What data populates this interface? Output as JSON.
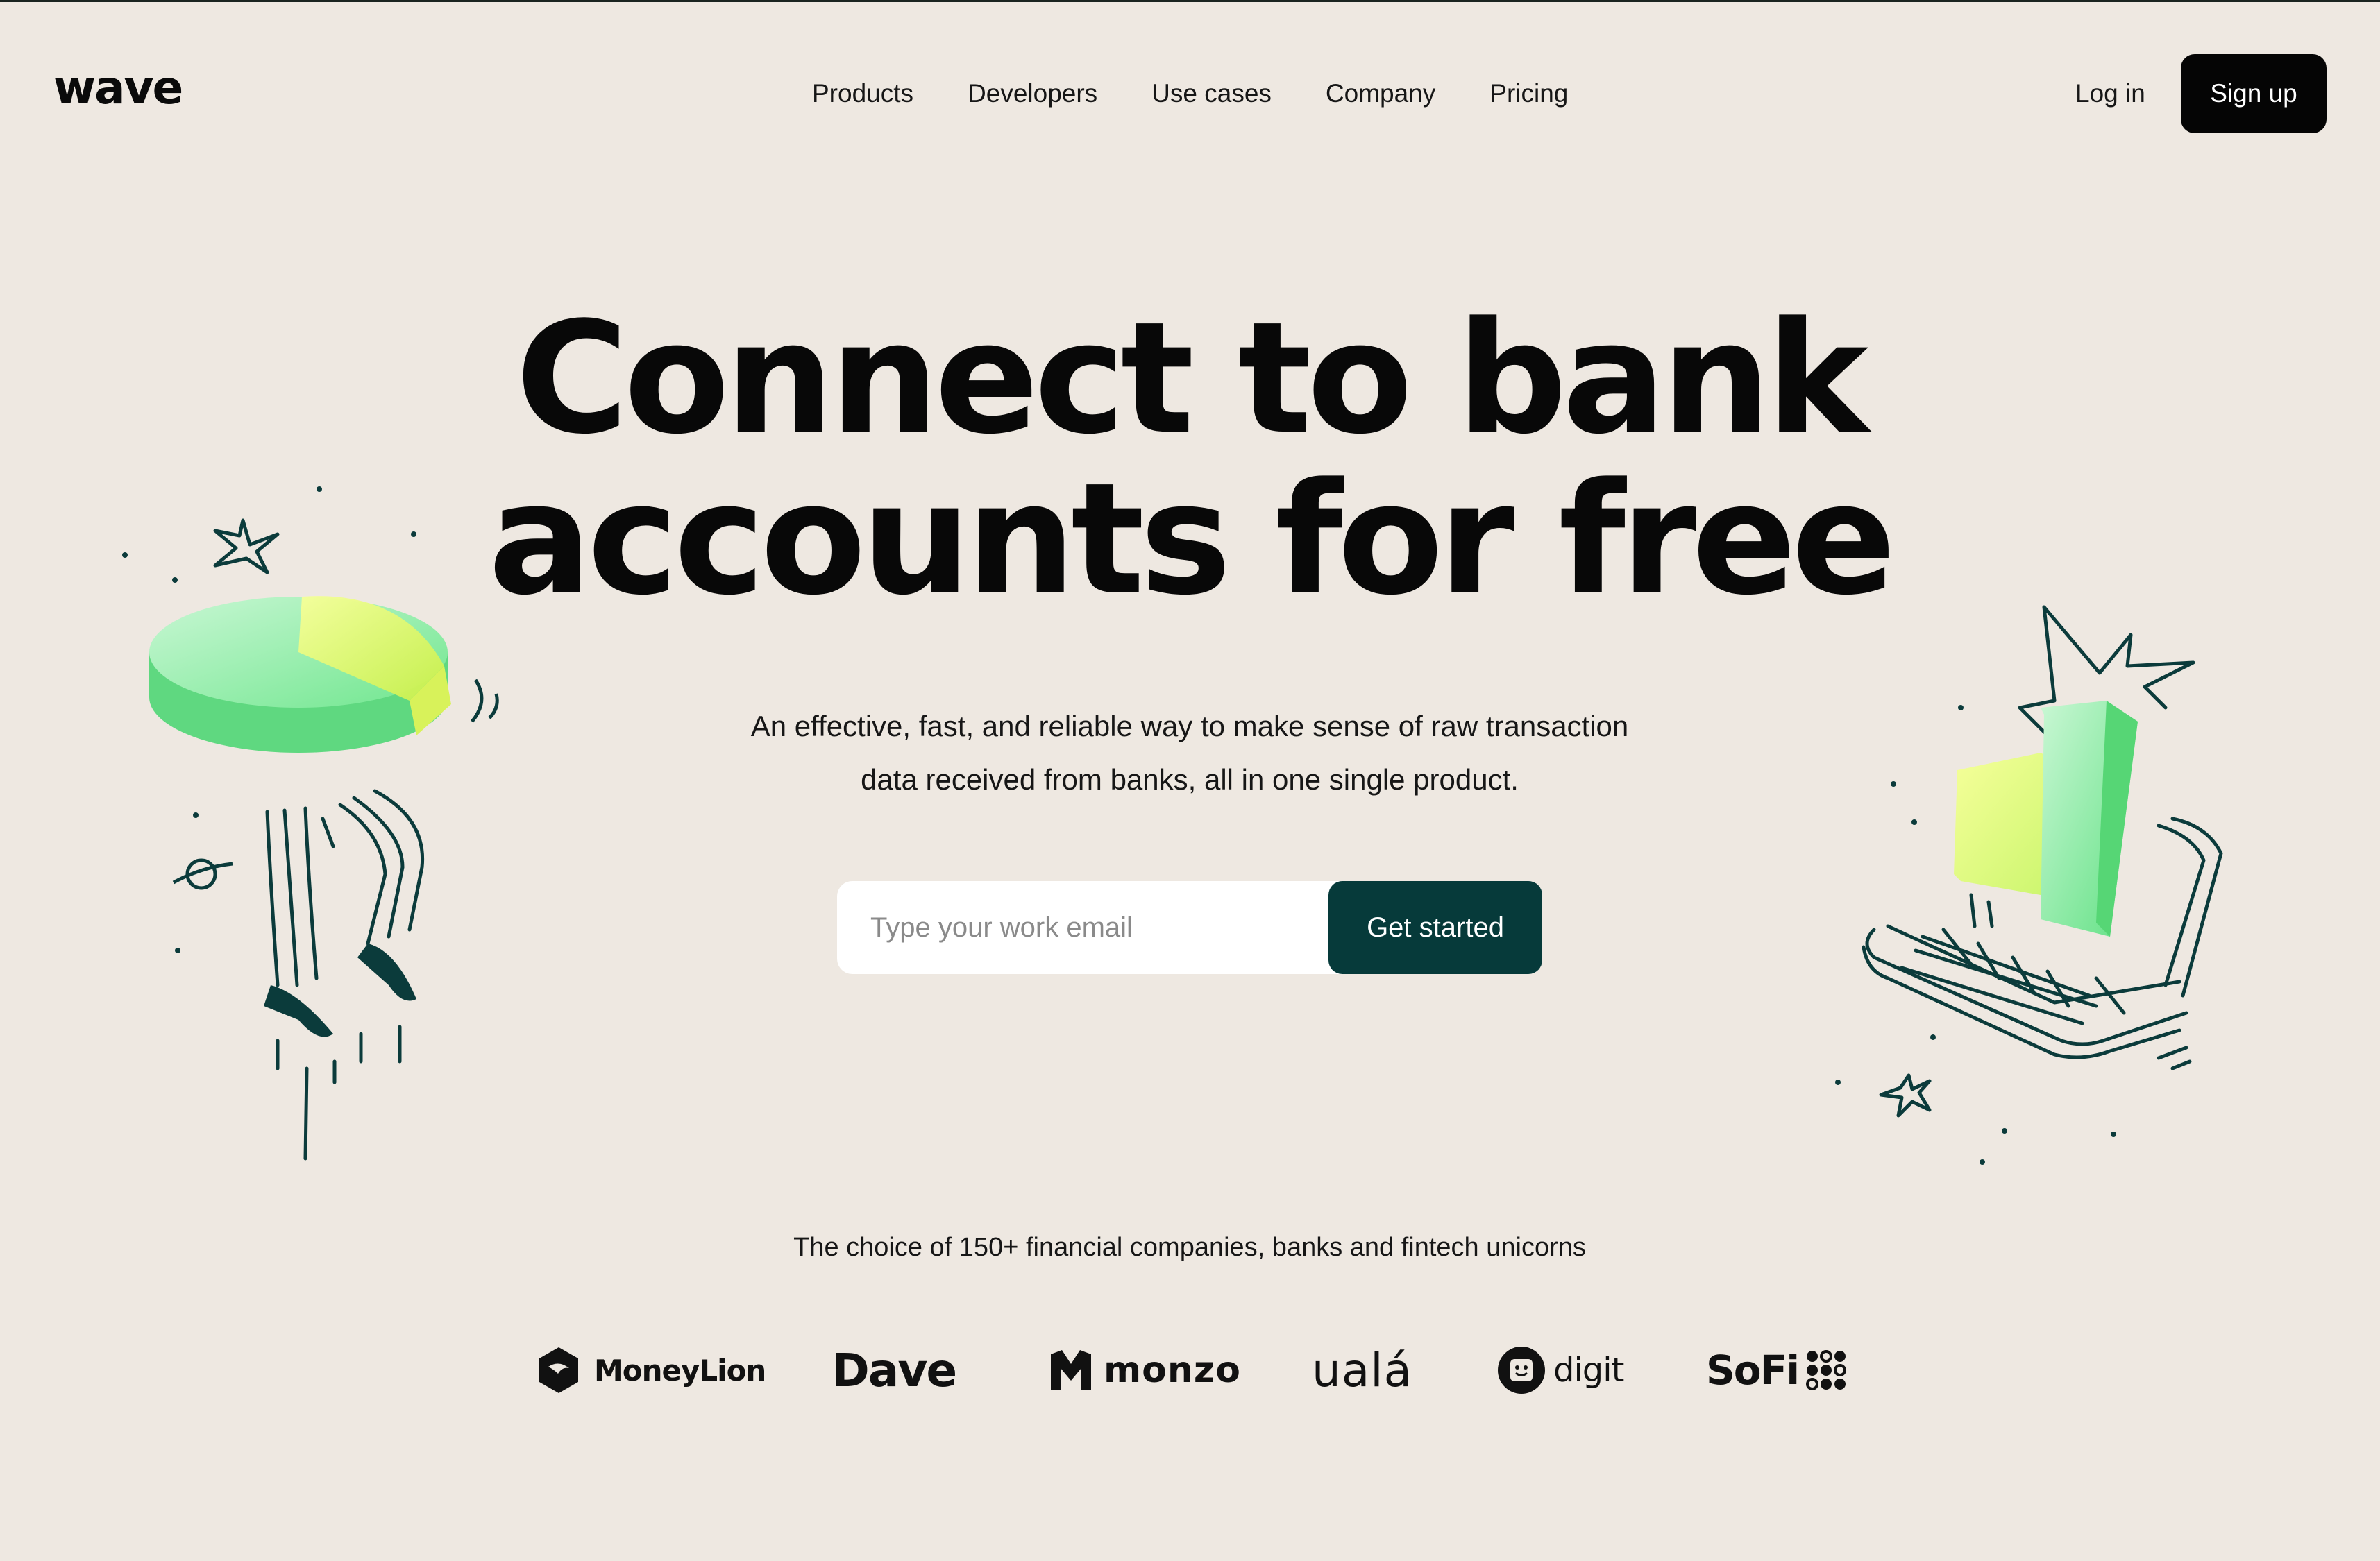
{
  "header": {
    "logo": "wave",
    "nav": [
      "Products",
      "Developers",
      "Use cases",
      "Company",
      "Pricing"
    ],
    "login": "Log in",
    "signup": "Sign up"
  },
  "hero": {
    "title_line1": "Connect to bank",
    "title_line2": "accounts for free",
    "subtitle_line1": "An effective, fast, and reliable way to make sense of raw transaction",
    "subtitle_line2": "data received from banks, all in one single product.",
    "email_placeholder": "Type your work email",
    "cta": "Get started"
  },
  "trust": {
    "text": "The choice of 150+ financial companies, banks and fintech unicorns",
    "brands": [
      "MoneyLion",
      "Dave",
      "monzo",
      "ualá",
      "digit",
      "SoFi"
    ]
  },
  "colors": {
    "background": "#eee8e1",
    "dark_teal": "#063a3a",
    "black": "#050505",
    "green_light": "#8ff0a8",
    "yellow_green": "#ecff7a"
  }
}
